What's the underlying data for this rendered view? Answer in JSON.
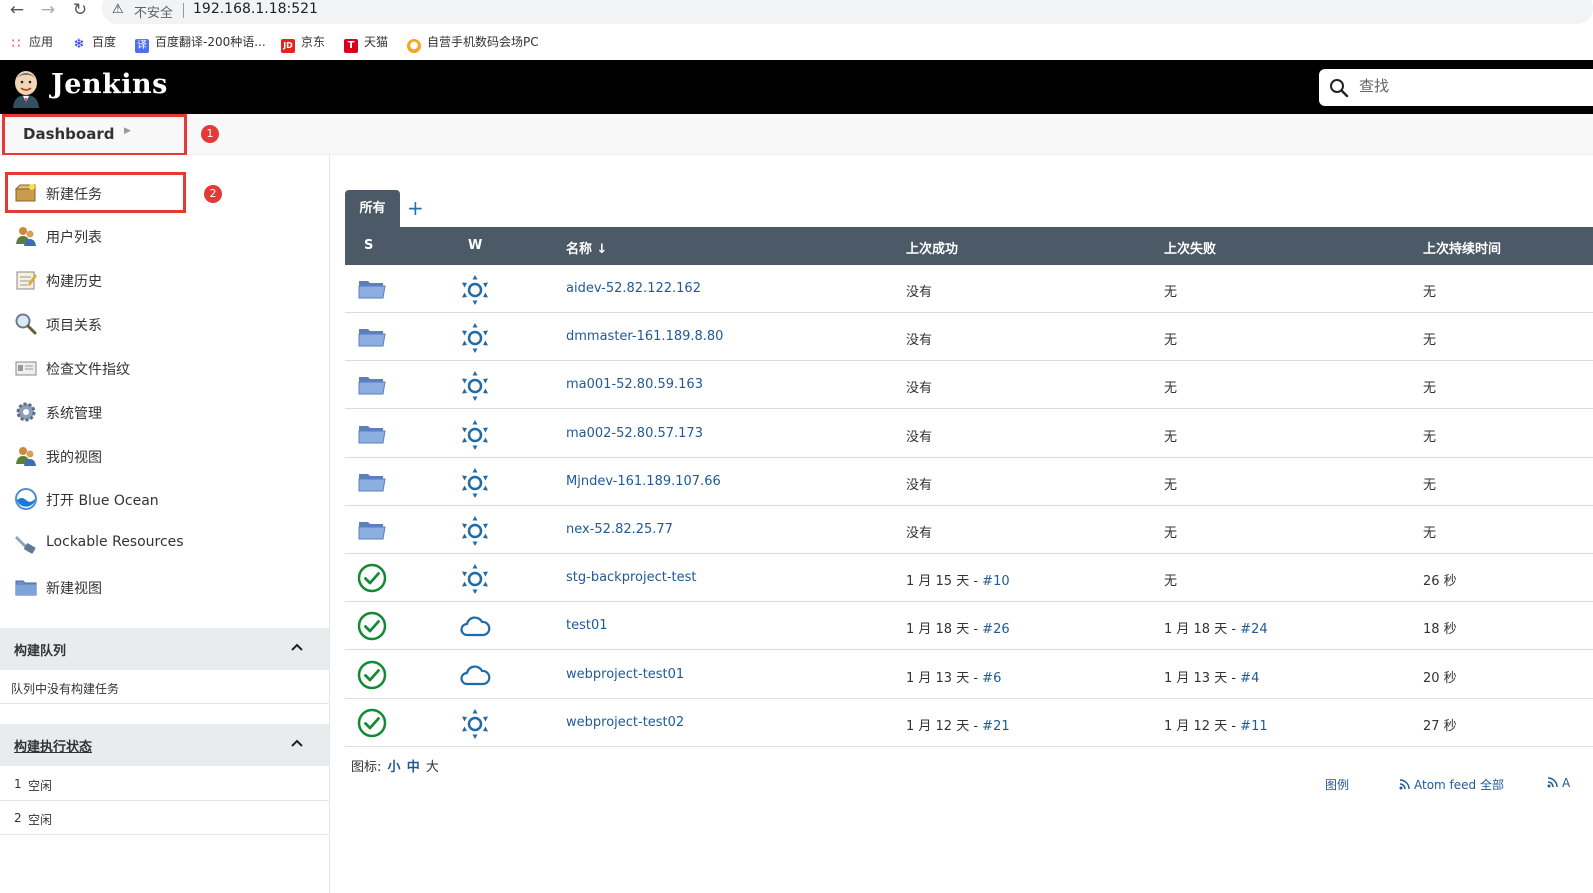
{
  "browser": {
    "security": "不安全",
    "url": "192.168.1.18:521"
  },
  "bookmarks": [
    {
      "label": "应用",
      "icon": "apps-grid-icon",
      "color": "#e8453c"
    },
    {
      "label": "百度",
      "icon": "baidu-paw-icon",
      "color": "#2932e1"
    },
    {
      "label": "百度翻译-200种语...",
      "icon": "translate-icon",
      "color": "#4e6ef2"
    },
    {
      "label": "京东",
      "icon": "jd-icon",
      "color": "#e1251b"
    },
    {
      "label": "天猫",
      "icon": "tmall-icon",
      "color": "#d6001c"
    },
    {
      "label": "自营手机数码会场PC",
      "icon": "shop-icon",
      "color": "#f5a623"
    }
  ],
  "header": {
    "title": "Jenkins",
    "search_placeholder": "查找"
  },
  "breadcrumb": {
    "label": "Dashboard"
  },
  "annotations": {
    "badge1": "1",
    "badge2": "2"
  },
  "sidebar": {
    "items": [
      {
        "label": "新建任务",
        "icon": "new-item-icon"
      },
      {
        "label": "用户列表",
        "icon": "users-icon"
      },
      {
        "label": "构建历史",
        "icon": "notepad-icon"
      },
      {
        "label": "项目关系",
        "icon": "magnifier-icon"
      },
      {
        "label": "检查文件指纹",
        "icon": "fingerprint-icon"
      },
      {
        "label": "系统管理",
        "icon": "gear-icon"
      },
      {
        "label": "我的视图",
        "icon": "user-view-icon"
      },
      {
        "label": "打开 Blue Ocean",
        "icon": "blue-ocean-icon"
      },
      {
        "label": "Lockable Resources",
        "icon": "lock-resource-icon"
      },
      {
        "label": "新建视图",
        "icon": "folder-icon"
      }
    ],
    "queue": {
      "title": "构建队列",
      "empty_text": "队列中没有构建任务"
    },
    "executors": {
      "title": "构建执行状态",
      "rows": [
        {
          "num": "1",
          "state": "空闲"
        },
        {
          "num": "2",
          "state": "空闲"
        }
      ]
    }
  },
  "main": {
    "tab_all": "所有",
    "tab_add": "+",
    "columns": {
      "s": "S",
      "w": "W",
      "name": "名称",
      "sort": "↓",
      "last_success": "上次成功",
      "last_failure": "上次失败",
      "last_duration": "上次持续时间"
    },
    "jobs": [
      {
        "status": "folder",
        "weather": "sunny",
        "name": "aidev-52.82.122.162",
        "success": "没有",
        "success_build": "",
        "failure": "无",
        "failure_build": "",
        "duration": "无"
      },
      {
        "status": "folder",
        "weather": "sunny",
        "name": "dmmaster-161.189.8.80",
        "success": "没有",
        "success_build": "",
        "failure": "无",
        "failure_build": "",
        "duration": "无"
      },
      {
        "status": "folder",
        "weather": "sunny",
        "name": "ma001-52.80.59.163",
        "success": "没有",
        "success_build": "",
        "failure": "无",
        "failure_build": "",
        "duration": "无"
      },
      {
        "status": "folder",
        "weather": "sunny",
        "name": "ma002-52.80.57.173",
        "success": "没有",
        "success_build": "",
        "failure": "无",
        "failure_build": "",
        "duration": "无"
      },
      {
        "status": "folder",
        "weather": "sunny",
        "name": "Mjndev-161.189.107.66",
        "success": "没有",
        "success_build": "",
        "failure": "无",
        "failure_build": "",
        "duration": "无"
      },
      {
        "status": "folder",
        "weather": "sunny",
        "name": "nex-52.82.25.77",
        "success": "没有",
        "success_build": "",
        "failure": "无",
        "failure_build": "",
        "duration": "无"
      },
      {
        "status": "success",
        "weather": "sunny",
        "name": "stg-backproject-test",
        "success": "1 月 15 天 - ",
        "success_build": "#10",
        "failure": "无",
        "failure_build": "",
        "duration": "26 秒"
      },
      {
        "status": "success",
        "weather": "cloudy",
        "name": "test01",
        "success": "1 月 18 天 - ",
        "success_build": "#26",
        "failure": "1 月 18 天 - ",
        "failure_build": "#24",
        "duration": "18 秒"
      },
      {
        "status": "success",
        "weather": "cloudy",
        "name": "webproject-test01",
        "success": "1 月 13 天 - ",
        "success_build": "#6",
        "failure": "1 月 13 天 - ",
        "failure_build": "#4",
        "duration": "20 秒"
      },
      {
        "status": "success",
        "weather": "sunny",
        "name": "webproject-test02",
        "success": "1 月 12 天 - ",
        "success_build": "#21",
        "failure": "1 月 12 天 - ",
        "failure_build": "#11",
        "duration": "27 秒"
      }
    ],
    "icon_size": {
      "label": "图标:",
      "small": "小",
      "medium": "中",
      "large": "大"
    },
    "footer": {
      "legend": "图例",
      "atom_all": "Atom feed 全部",
      "atom_more": "A"
    }
  }
}
